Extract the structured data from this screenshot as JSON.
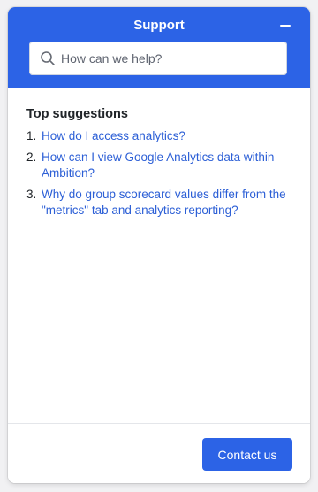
{
  "header": {
    "title": "Support",
    "minimize_icon": "minus-icon"
  },
  "search": {
    "placeholder": "How can we help?",
    "value": "",
    "icon": "search-icon"
  },
  "suggestions": {
    "title": "Top suggestions",
    "items": [
      {
        "number": "1.",
        "text": "How do I access analytics?"
      },
      {
        "number": "2.",
        "text": "How can I view Google Analytics data within Ambition?"
      },
      {
        "number": "3.",
        "text": "Why do group scorecard values differ from the \"metrics\" tab and analytics reporting?"
      }
    ]
  },
  "footer": {
    "contact_label": "Contact us"
  },
  "colors": {
    "brand": "#2c63e6",
    "link": "#2c5fd6",
    "background": "#f1f1f3"
  }
}
